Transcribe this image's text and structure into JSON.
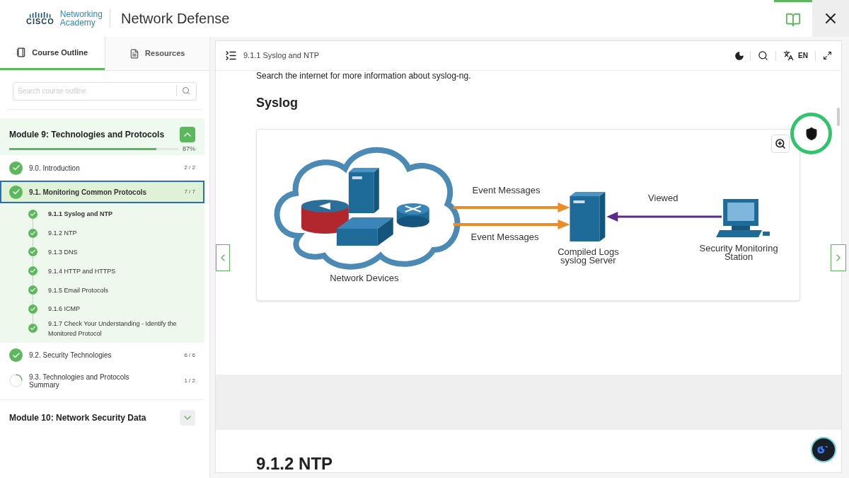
{
  "header": {
    "brand_mark": "CISCO",
    "brand_line1": "Networking",
    "brand_line2": "Academy",
    "title": "Network Defense"
  },
  "sidebar": {
    "tabs": [
      {
        "label": "Course Outline",
        "selected": true
      },
      {
        "label": "Resources",
        "selected": false
      }
    ],
    "search": {
      "placeholder": "Search course outline"
    },
    "modules": [
      {
        "title": "Module 9: Technologies and Protocols",
        "expanded": true,
        "level": 0.87,
        "percent": "87%",
        "sections": [
          {
            "title": "9.0. Introduction",
            "count": "2 / 2",
            "complete": true,
            "selected": false
          },
          {
            "title": "9.1. Monitoring Common Protocols",
            "count": "7 / 7",
            "complete": true,
            "selected": true,
            "children": [
              {
                "title": "9.1.1 Syslog and NTP",
                "current": true
              },
              {
                "title": "9.1.2 NTP",
                "current": false
              },
              {
                "title": "9.1.3 DNS",
                "current": false
              },
              {
                "title": "9.1.4 HTTP and HTTPS",
                "current": false
              },
              {
                "title": "9.1.5 Email Protocols",
                "current": false
              },
              {
                "title": "9.1.6 ICMP",
                "current": false
              },
              {
                "title": "9.1.7 Check Your Understanding - Identify the Monitored Protocol",
                "current": false
              }
            ]
          },
          {
            "title": "9.2. Security Technologies",
            "count": "6 / 6",
            "complete": true,
            "selected": false
          },
          {
            "title": "9.3. Technologies and Protocols Summary",
            "count": "1 / 2",
            "complete": false,
            "selected": false
          }
        ]
      },
      {
        "title": "Module 10: Network Security Data",
        "expanded": false
      }
    ]
  },
  "content": {
    "breadcrumb": "9.1.1 Syslog and NTP",
    "language": "EN",
    "intro": "Search the internet for more information about syslog-ng.",
    "heading": "Syslog",
    "diagram": {
      "messages": [
        "Event Messages",
        "Event Messages"
      ],
      "server_label": [
        "Compiled Logs",
        "syslog Server"
      ],
      "viewed": "Viewed",
      "station_label": [
        "Security Monitoring",
        "Station"
      ],
      "devices_label": "Network Devices"
    },
    "next_heading": "9.1.2 NTP"
  }
}
